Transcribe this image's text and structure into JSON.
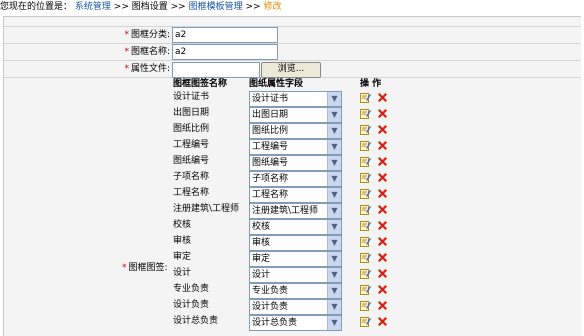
{
  "breadcrumb": {
    "prefix": "您现在的位置是：",
    "items": [
      "系统管理",
      "图档设置",
      "图框模板管理"
    ],
    "separator": ">>",
    "current": "修改"
  },
  "form": {
    "category_label": "图框分类:",
    "category_value": "a2",
    "name_label": "图框名称:",
    "name_value": "a2",
    "attr_file_label": "属性文件:",
    "browse_label": "浏览...",
    "tags_label": "图框图签:"
  },
  "table": {
    "col_name": "图框图签名称",
    "col_field": "图纸属性字段",
    "col_op": "操  作",
    "rows": [
      {
        "name": "设计证书",
        "field": "设计证书"
      },
      {
        "name": "出图日期",
        "field": "出图日期"
      },
      {
        "name": "图纸比例",
        "field": "图纸比例"
      },
      {
        "name": "工程编号",
        "field": "工程编号"
      },
      {
        "name": "图纸编号",
        "field": "图纸编号"
      },
      {
        "name": "子项名称",
        "field": "子项名称"
      },
      {
        "name": "工程名称",
        "field": "工程名称"
      },
      {
        "name": "注册建筑\\工程师",
        "field": "注册建筑\\工程师"
      },
      {
        "name": "校核",
        "field": "校核"
      },
      {
        "name": "审核",
        "field": "审核"
      },
      {
        "name": "审定",
        "field": "审定"
      },
      {
        "name": "设计",
        "field": "设计"
      },
      {
        "name": "专业负责",
        "field": "专业负责"
      },
      {
        "name": "设计负责",
        "field": "设计负责"
      },
      {
        "name": "设计总负责",
        "field": "设计总负责"
      }
    ]
  },
  "icons": {
    "edit": "edit-icon",
    "delete": "delete-icon",
    "dropdown": "chevron-down-icon"
  },
  "colors": {
    "link": "#1a56a8",
    "current": "#e08a00",
    "required": "#d00000",
    "delete": "#d81e06"
  }
}
